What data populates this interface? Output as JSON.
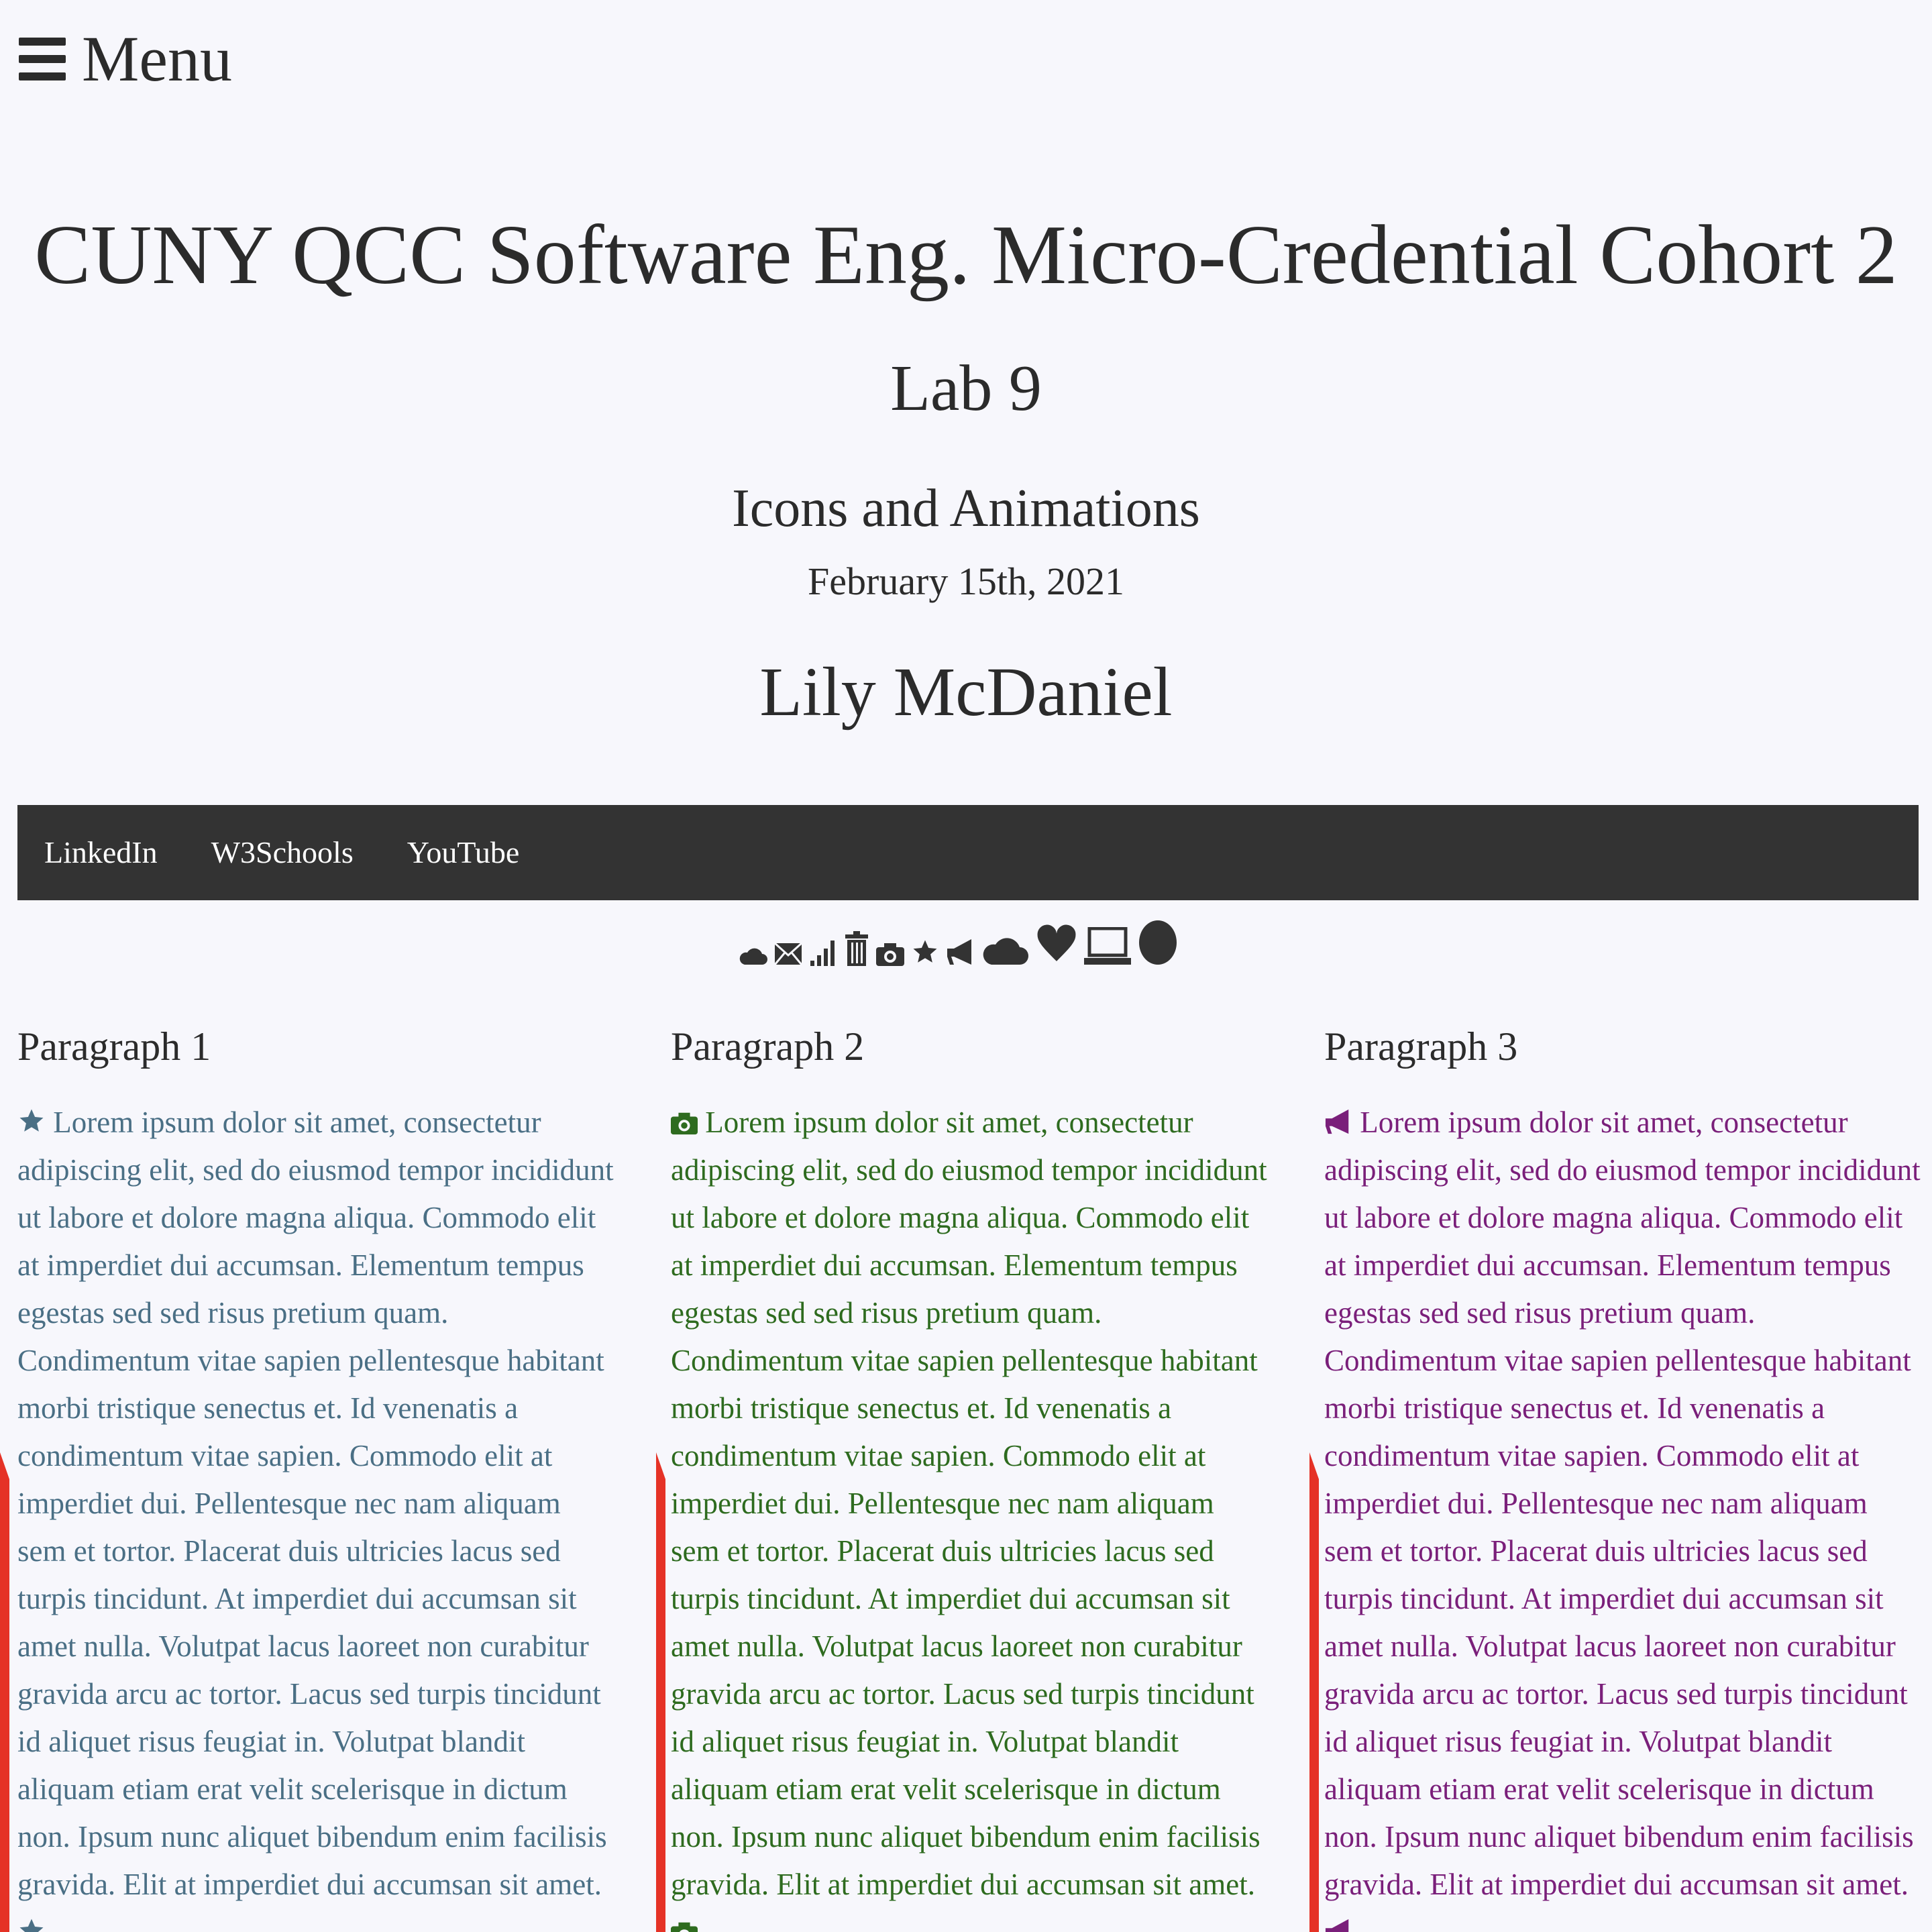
{
  "menu": {
    "label": "Menu"
  },
  "header": {
    "title": "CUNY QCC Software Eng. Micro-Credential Cohort 2",
    "lab": "Lab 9",
    "subtitle": "Icons and Animations",
    "date": "February 15th, 2021",
    "author": "Lily McDaniel"
  },
  "nav": {
    "links": [
      "LinkedIn",
      "W3Schools",
      "YouTube"
    ]
  },
  "icons": [
    "cloud-icon",
    "envelope-icon",
    "signal-icon",
    "trash-icon",
    "camera-icon",
    "star-icon",
    "bullhorn-icon",
    "cloud-icon",
    "heart-icon",
    "laptop-icon",
    "circle-icon"
  ],
  "colors": {
    "background": "#f7f7fc",
    "navbar": "#333333",
    "paragraph1": "#4a6f85",
    "paragraph2": "#2e6b1f",
    "paragraph3": "#7a1f7a",
    "accent_bar": "#e53226"
  },
  "paragraphs": [
    {
      "heading": "Paragraph 1",
      "icon": "star-icon",
      "text": "Lorem ipsum dolor sit amet, consectetur adipiscing elit, sed do eiusmod tempor incididunt ut labore et dolore magna aliqua. Commodo elit at imperdiet dui accumsan. Elementum tempus egestas sed sed risus pretium quam. Condimentum vitae sapien pellentesque habitant morbi tristique senectus et. Id venenatis a condimentum vitae sapien. Commodo elit at imperdiet dui. Pellentesque nec nam aliquam sem et tortor. Placerat duis ultricies lacus sed turpis tincidunt. At imperdiet dui accumsan sit amet nulla. Volutpat lacus laoreet non curabitur gravida arcu ac tortor. Lacus sed turpis tincidunt id aliquet risus feugiat in. Volutpat blandit aliquam etiam erat velit scelerisque in dictum non. Ipsum nunc aliquet bibendum enim facilisis gravida. Elit at imperdiet dui accumsan sit amet."
    },
    {
      "heading": "Paragraph 2",
      "icon": "camera-icon",
      "text": "Lorem ipsum dolor sit amet, consectetur adipiscing elit, sed do eiusmod tempor incididunt ut labore et dolore magna aliqua. Commodo elit at imperdiet dui accumsan. Elementum tempus egestas sed sed risus pretium quam. Condimentum vitae sapien pellentesque habitant morbi tristique senectus et. Id venenatis a condimentum vitae sapien. Commodo elit at imperdiet dui. Pellentesque nec nam aliquam sem et tortor. Placerat duis ultricies lacus sed turpis tincidunt. At imperdiet dui accumsan sit amet nulla. Volutpat lacus laoreet non curabitur gravida arcu ac tortor. Lacus sed turpis tincidunt id aliquet risus feugiat in. Volutpat blandit aliquam etiam erat velit scelerisque in dictum non. Ipsum nunc aliquet bibendum enim facilisis gravida. Elit at imperdiet dui accumsan sit amet."
    },
    {
      "heading": "Paragraph 3",
      "icon": "bullhorn-icon",
      "text": "Lorem ipsum dolor sit amet, consectetur adipiscing elit, sed do eiusmod tempor incididunt ut labore et dolore magna aliqua. Commodo elit at imperdiet dui accumsan. Elementum tempus egestas sed sed risus pretium quam. Condimentum vitae sapien pellentesque habitant morbi tristique senectus et. Id venenatis a condimentum vitae sapien. Commodo elit at imperdiet dui. Pellentesque nec nam aliquam sem et tortor. Placerat duis ultricies lacus sed turpis tincidunt. At imperdiet dui accumsan sit amet nulla. Volutpat lacus laoreet non curabitur gravida arcu ac tortor. Lacus sed turpis tincidunt id aliquet risus feugiat in. Volutpat blandit aliquam etiam erat velit scelerisque in dictum non. Ipsum nunc aliquet bibendum enim facilisis gravida. Elit at imperdiet dui accumsan sit amet."
    }
  ]
}
